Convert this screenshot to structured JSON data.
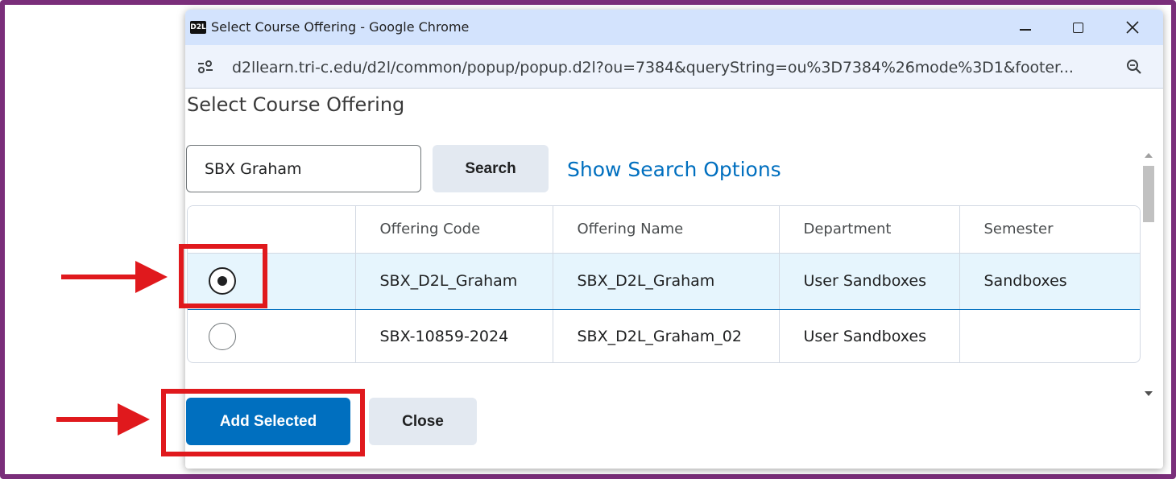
{
  "window": {
    "favicon_text": "D2L",
    "title": "Select Course Offering - Google Chrome",
    "url": "d2llearn.tri-c.edu/d2l/common/popup/popup.d2l?ou=7384&queryString=ou%3D7384%26mode%3D1&footer..."
  },
  "page": {
    "heading": "Select Course Offering",
    "search": {
      "value": "SBX Graham",
      "button_label": "Search",
      "options_link": "Show Search Options"
    },
    "table": {
      "columns": [
        "",
        "Offering Code",
        "Offering Name",
        "Department",
        "Semester"
      ],
      "rows": [
        {
          "selected": true,
          "code": "SBX_D2L_Graham",
          "name": "SBX_D2L_Graham",
          "department": "User Sandboxes",
          "semester": "Sandboxes"
        },
        {
          "selected": false,
          "code": "SBX-10859-2024",
          "name": "SBX_D2L_Graham_02",
          "department": "User Sandboxes",
          "semester": ""
        }
      ]
    },
    "buttons": {
      "add_selected": "Add Selected",
      "close": "Close"
    }
  },
  "annotations": {
    "highlight_color": "#e0191d",
    "frame_color": "#7a2e7a",
    "primary_color": "#006fbf"
  }
}
